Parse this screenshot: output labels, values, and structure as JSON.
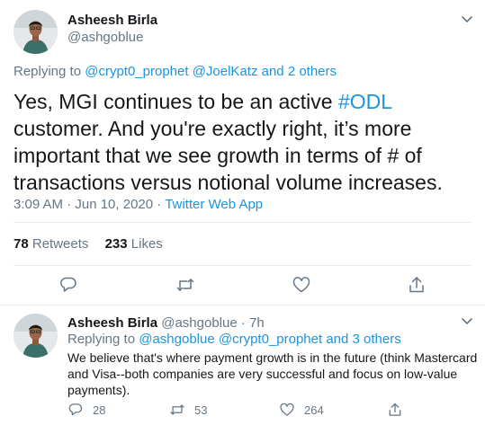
{
  "main_tweet": {
    "author_name": "Asheesh Birla",
    "author_handle": "@ashgoblue",
    "replying_prefix": "Replying to",
    "replying_user1": "@crypt0_prophet",
    "replying_user2": "@JoelKatz",
    "replying_suffix": "and 2 others",
    "text_before_hashtag": "Yes, MGI continues to be an active ",
    "hashtag": "#ODL",
    "text_after_hashtag": " customer. And you're exactly right, it’s more important that we see growth in terms of # of transactions versus notional volume increases.",
    "timestamp": "3:09 AM · Jun 10, 2020",
    "separator": "·",
    "source": "Twitter Web App",
    "retweets_count": "78",
    "retweets_label": "Retweets",
    "likes_count": "233",
    "likes_label": "Likes",
    "actions": [
      "reply-icon",
      "retweet-icon",
      "like-icon",
      "share-icon"
    ]
  },
  "reply_tweet": {
    "author_name": "Asheesh Birla",
    "author_handle": "@ashgoblue",
    "time": "· 7h",
    "replying_prefix": "Replying to",
    "replying_user1": "@ashgoblue",
    "replying_user2": "@crypt0_prophet",
    "replying_suffix": "and 3 others",
    "text": "We believe that's where payment growth is in the future (think Mastercard and Visa--both companies are very successful and focus on low-value payments).",
    "reply_count": "28",
    "retweet_count": "53",
    "like_count": "264"
  },
  "colors": {
    "link": "#1b95e0",
    "secondary_text": "#657786",
    "primary_text": "#14171a",
    "divider": "#e6ecf0"
  }
}
